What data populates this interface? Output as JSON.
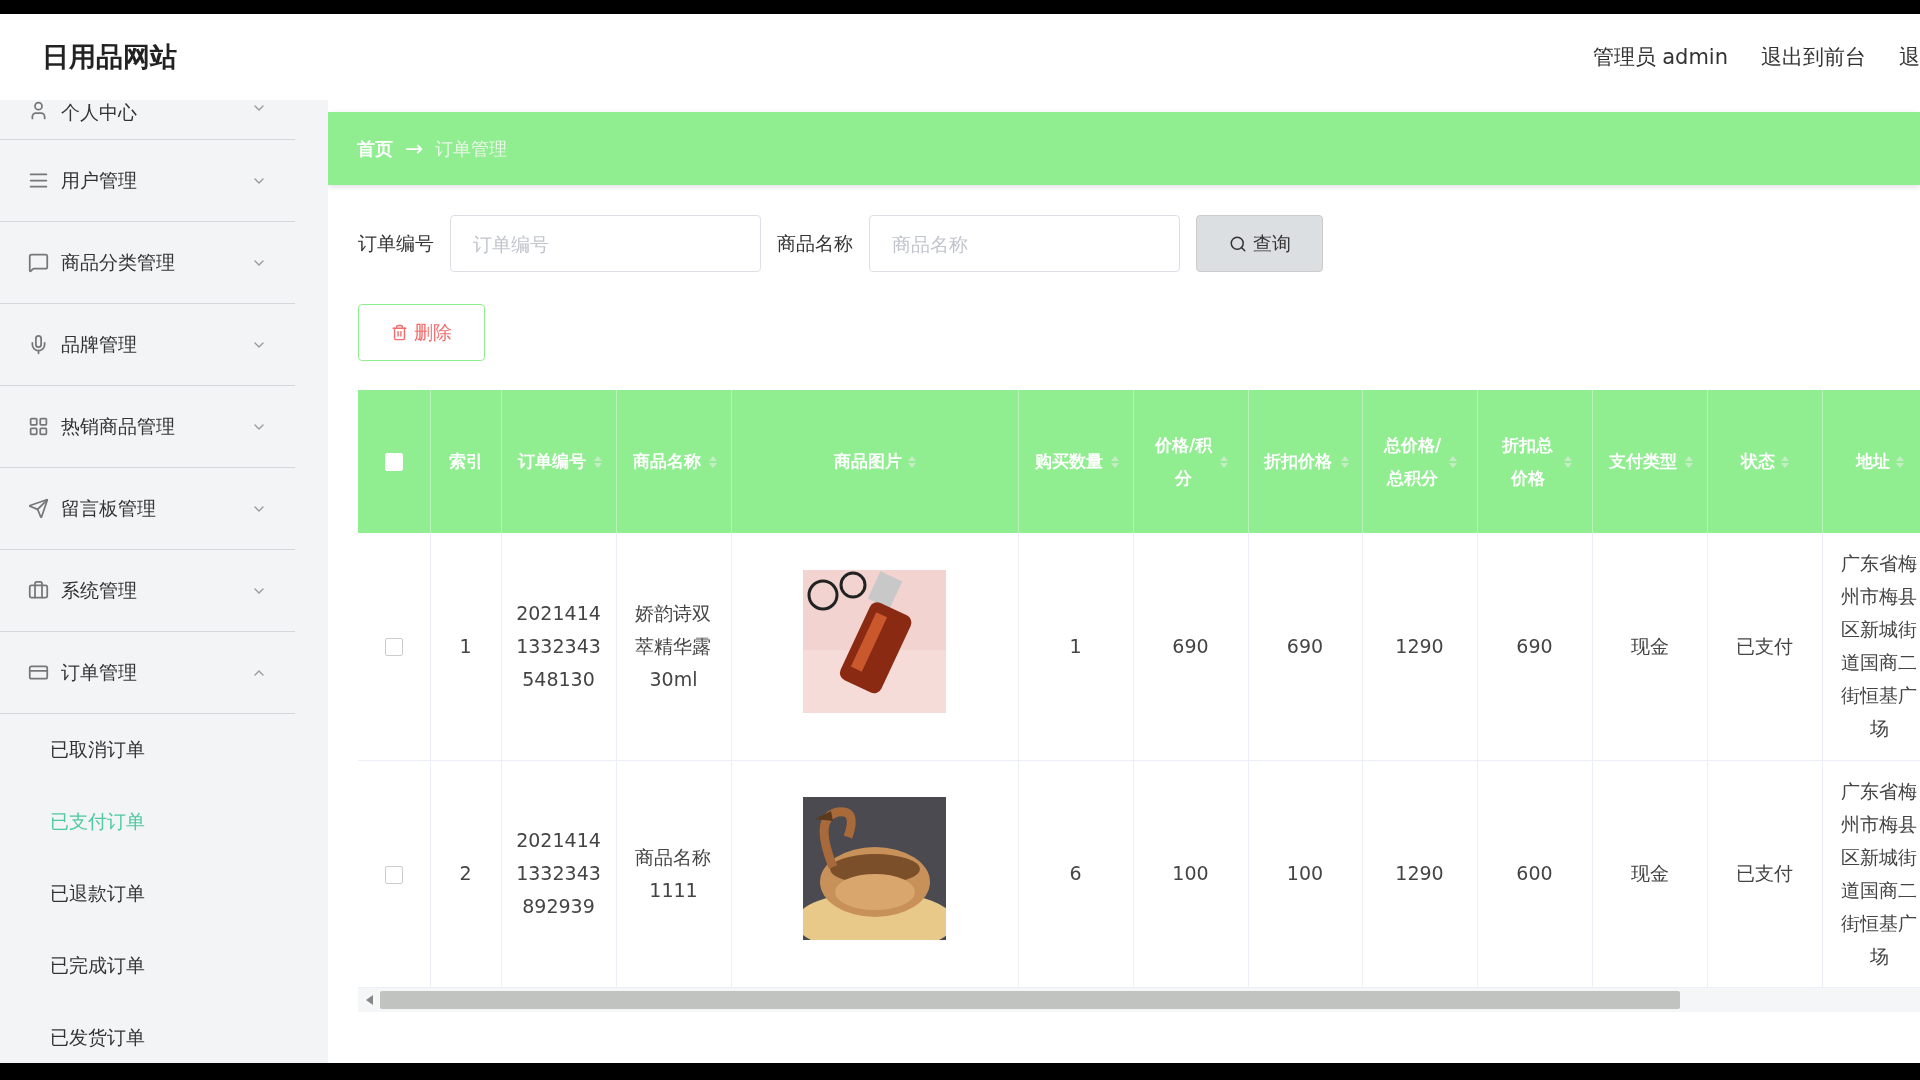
{
  "header": {
    "site_title": "日用品网站",
    "user": "管理员 admin",
    "links": [
      "退出到前台",
      "退"
    ]
  },
  "sidebar": {
    "items": [
      {
        "label": "个人中心",
        "expanded": false
      },
      {
        "label": "用户管理",
        "expanded": false
      },
      {
        "label": "商品分类管理",
        "expanded": false
      },
      {
        "label": "品牌管理",
        "expanded": false
      },
      {
        "label": "热销商品管理",
        "expanded": false
      },
      {
        "label": "留言板管理",
        "expanded": false
      },
      {
        "label": "系统管理",
        "expanded": false
      },
      {
        "label": "订单管理",
        "expanded": true,
        "children": [
          {
            "label": "已取消订单",
            "selected": false
          },
          {
            "label": "已支付订单",
            "selected": true
          },
          {
            "label": "已退款订单",
            "selected": false
          },
          {
            "label": "已完成订单",
            "selected": false
          },
          {
            "label": "已发货订单",
            "selected": false
          }
        ]
      }
    ]
  },
  "breadcrumb": [
    "首页",
    "→",
    "订单管理"
  ],
  "search": {
    "fields": [
      {
        "label": "订单编号",
        "placeholder": "订单编号"
      },
      {
        "label": "商品名称",
        "placeholder": "商品名称"
      }
    ],
    "button": "查询"
  },
  "delete_button": "删除",
  "table": {
    "header_checked": false,
    "columns": [
      {
        "label": "索引",
        "sortable": false
      },
      {
        "label": "订单编号",
        "sortable": true
      },
      {
        "label": "商品名称",
        "sortable": true
      },
      {
        "label": "商品图片",
        "sortable": true
      },
      {
        "label": "购买数量",
        "sortable": true
      },
      {
        "label": "价格/积分",
        "sortable": true
      },
      {
        "label": "折扣价格",
        "sortable": true
      },
      {
        "label": "总价格/总积分",
        "sortable": true
      },
      {
        "label": "折扣总价格",
        "sortable": true
      },
      {
        "label": "支付类型",
        "sortable": true
      },
      {
        "label": "状态",
        "sortable": true
      },
      {
        "label": "地址",
        "sortable": true
      }
    ],
    "rows": [
      {
        "checked": false,
        "cells": [
          "1",
          "2021414 1332343 548130",
          "娇韵诗双萃精华露30ml",
          "",
          "1",
          "690",
          "690",
          "1290",
          "690",
          "现金",
          "已支付",
          "广东省梅州市梅县区新城街道国商二街恒基广场"
        ]
      },
      {
        "checked": false,
        "cells": [
          "2",
          "2021414 1332343 892939",
          "商品名称1111",
          "",
          "6",
          "100",
          "100",
          "1290",
          "600",
          "现金",
          "已支付",
          "广东省梅州市梅县区新城街道国商二街恒基广场"
        ]
      }
    ]
  }
}
